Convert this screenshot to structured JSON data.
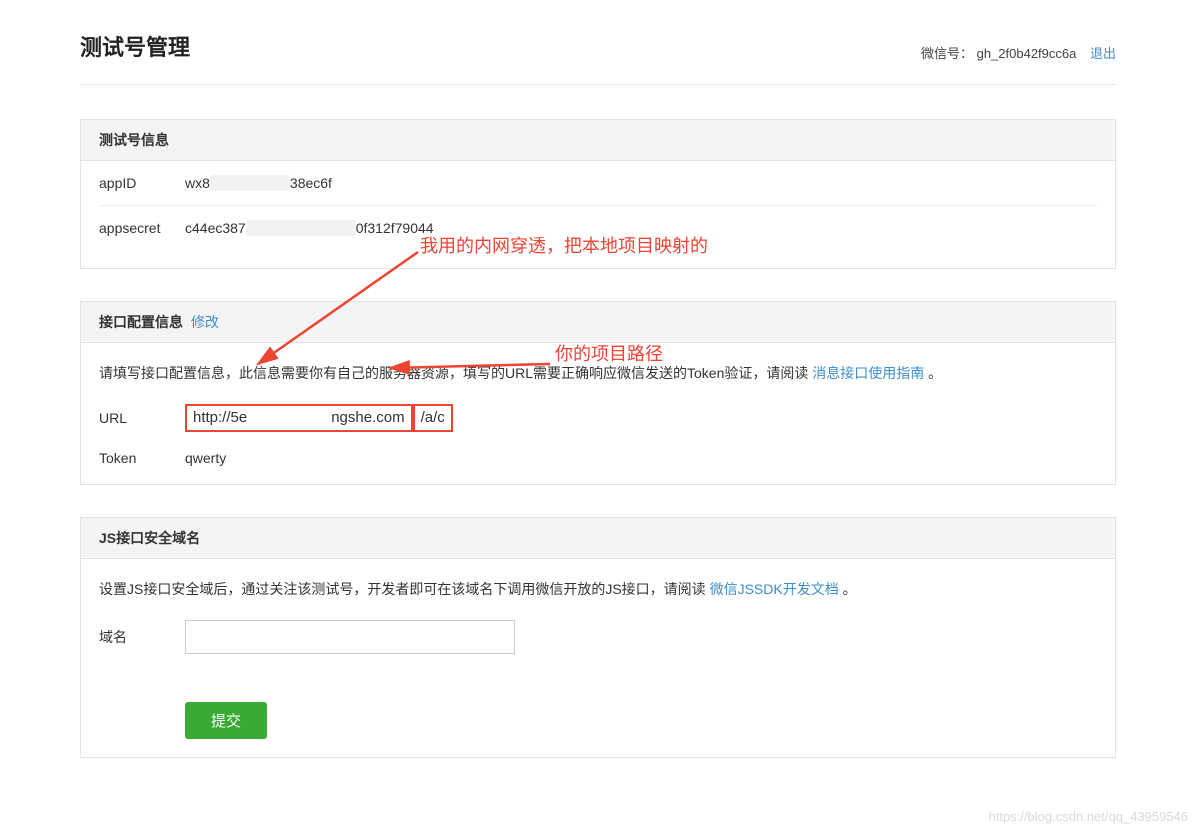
{
  "header": {
    "title": "测试号管理",
    "wechat_label": "微信号：",
    "wechat_id": "gh_2f0b42f9cc6a",
    "logout": "退出"
  },
  "section_info": {
    "title": "测试号信息",
    "appid_label": "appID",
    "appid_prefix": "wx8",
    "appid_suffix": "38ec6f",
    "appsecret_label": "appsecret",
    "appsecret_prefix": "c44ec387",
    "appsecret_suffix": "0f312f79044"
  },
  "section_interface": {
    "title": "接口配置信息",
    "modify": "修改",
    "desc_prefix": "请填写接口配置信息，此信息需要你有自己的服务器资源，填写的URL需要正确响应微信发送的Token验证，请阅读",
    "desc_link": "消息接口使用指南",
    "desc_suffix": "。",
    "url_label": "URL",
    "url_box1_prefix": "http://5e",
    "url_box1_suffix": "ngshe.com",
    "url_box2": "/a/c",
    "token_label": "Token",
    "token_value": "qwerty"
  },
  "section_js": {
    "title": "JS接口安全域名",
    "desc_prefix": "设置JS接口安全域后，通过关注该测试号，开发者即可在该域名下调用微信开放的JS接口，请阅读",
    "desc_link": "微信JSSDK开发文档",
    "desc_suffix": "。",
    "domain_label": "域名",
    "domain_value": "",
    "submit": "提交"
  },
  "annotations": {
    "top": "我用的内网穿透，把本地项目映射的",
    "right": "你的项目路径"
  },
  "watermark": "https://blog.csdn.net/qq_43959546"
}
